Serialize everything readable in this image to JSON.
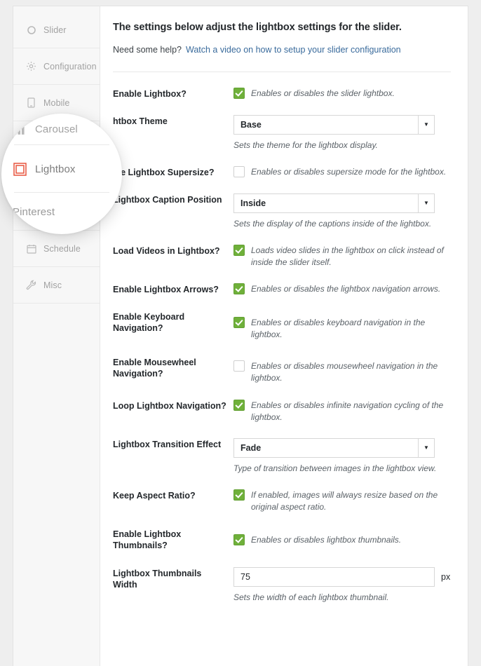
{
  "sidebar": {
    "items": [
      {
        "label": "Slider",
        "icon": "slider-ring-icon",
        "active": false
      },
      {
        "label": "Configuration",
        "icon": "gear-icon",
        "active": false
      },
      {
        "label": "Mobile",
        "icon": "mobile-phone-icon",
        "active": false
      },
      {
        "label": "Carousel",
        "icon": "carousel-bars-icon",
        "active": false
      },
      {
        "label": "Lightbox",
        "icon": "lightbox-frame-icon",
        "active": true
      },
      {
        "label": "Pinterest",
        "icon": "pinterest-icon",
        "active": false
      },
      {
        "label": "Schedule",
        "icon": "calendar-icon",
        "active": false
      },
      {
        "label": "Misc",
        "icon": "wrench-icon",
        "active": false
      }
    ]
  },
  "header": {
    "title": "The settings below adjust the lightbox settings for the slider.",
    "help_prefix": "Need some help?",
    "help_link": "Watch a video on how to setup your slider configuration"
  },
  "spotlight": {
    "carousel_label": "Carousel",
    "lightbox_label": "Lightbox",
    "pinterest_label": "Pinterest"
  },
  "colors": {
    "accent": "#e8563f",
    "checkbox_on": "#6fb03a",
    "link": "#3a6b9c",
    "page_bg": "#eeeeee",
    "sidebar_bg": "#f7f7f7"
  },
  "settings": {
    "enable_lightbox": {
      "label": "Enable Lightbox?",
      "type": "checkbox",
      "checked": true,
      "hint": "Enables or disables the slider lightbox."
    },
    "lightbox_theme": {
      "label": "Lightbox Theme",
      "label_clipped": "htbox Theme",
      "type": "select",
      "value": "Base",
      "hint": "Sets the theme for the lightbox display."
    },
    "lightbox_supersize": {
      "label": "Enable Lightbox Supersize?",
      "label_clipped": "ble Lightbox Supersize?",
      "type": "checkbox",
      "checked": false,
      "hint": "Enables or disables supersize mode for the lightbox."
    },
    "caption_position": {
      "label": "Lightbox Caption Position",
      "type": "select",
      "value": "Inside",
      "hint": "Sets the display of the captions inside of the lightbox."
    },
    "load_videos": {
      "label": "Load Videos in Lightbox?",
      "type": "checkbox",
      "checked": true,
      "hint": "Loads video slides in the lightbox on click instead of inside the slider itself."
    },
    "lightbox_arrows": {
      "label": "Enable Lightbox Arrows?",
      "type": "checkbox",
      "checked": true,
      "hint": "Enables or disables the lightbox navigation arrows."
    },
    "keyboard_navigation": {
      "label": "Enable Keyboard Navigation?",
      "type": "checkbox",
      "checked": true,
      "hint": "Enables or disables keyboard navigation in the lightbox."
    },
    "mousewheel_navigation": {
      "label": "Enable Mousewheel Navigation?",
      "type": "checkbox",
      "checked": false,
      "hint": "Enables or disables mousewheel navigation in the lightbox."
    },
    "loop_navigation": {
      "label": "Loop Lightbox Navigation?",
      "type": "checkbox",
      "checked": true,
      "hint": "Enables or disables infinite navigation cycling of the lightbox."
    },
    "transition_effect": {
      "label": "Lightbox Transition Effect",
      "type": "select",
      "value": "Fade",
      "hint": "Type of transition between images in the lightbox view."
    },
    "keep_aspect_ratio": {
      "label": "Keep Aspect Ratio?",
      "type": "checkbox",
      "checked": true,
      "hint": "If enabled, images will always resize based on the original aspect ratio."
    },
    "enable_thumbnails": {
      "label": "Enable Lightbox Thumbnails?",
      "type": "checkbox",
      "checked": true,
      "hint": "Enables or disables lightbox thumbnails."
    },
    "thumbnails_width": {
      "label": "Lightbox Thumbnails Width",
      "type": "text",
      "value": "75",
      "unit": "px",
      "hint": "Sets the width of each lightbox thumbnail."
    }
  }
}
